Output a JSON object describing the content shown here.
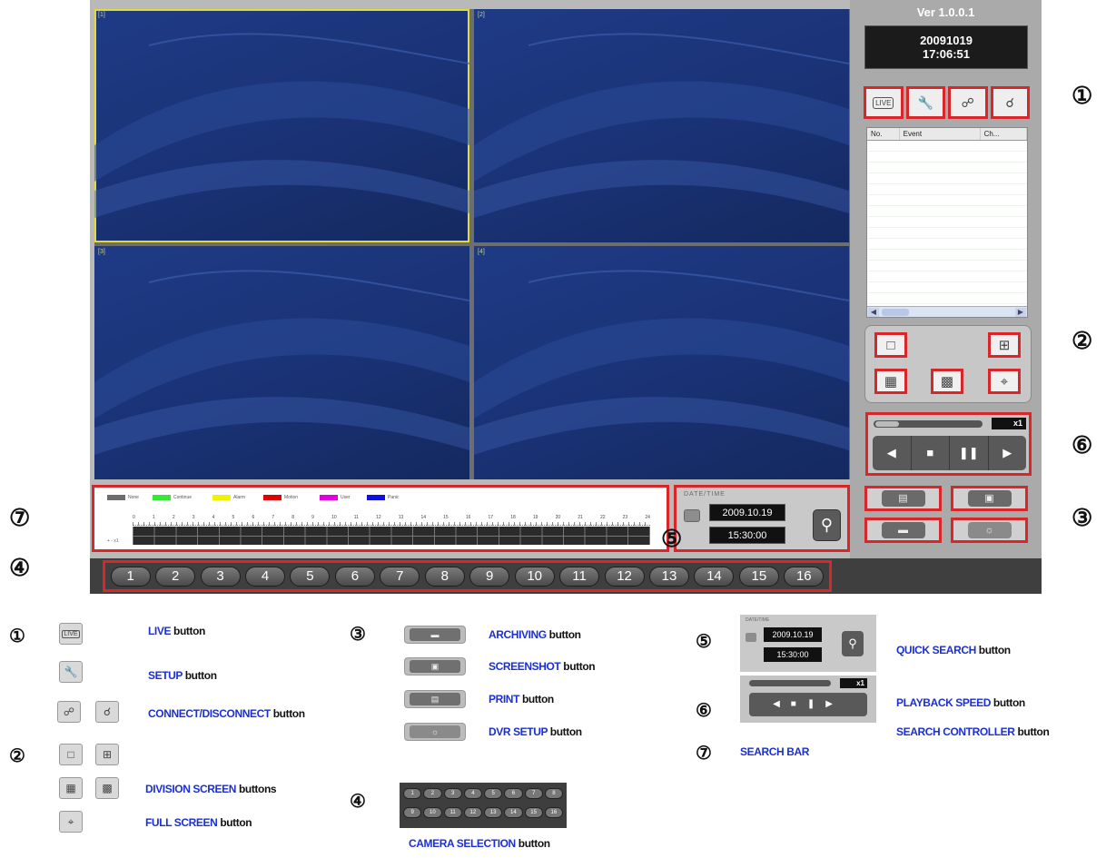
{
  "app": {
    "version": "Ver 1.0.0.1",
    "clock_date": "20091019",
    "clock_time": "17:06:51",
    "cameras": [
      {
        "label": "[1]",
        "selected": true
      },
      {
        "label": "[2]",
        "selected": false
      },
      {
        "label": "[3]",
        "selected": false
      },
      {
        "label": "[4]",
        "selected": false
      }
    ],
    "event_list": {
      "columns": [
        "No.",
        "Event",
        "Ch..."
      ]
    },
    "speed": "x1",
    "search_bar": {
      "legend": [
        "None",
        "Continue",
        "Alarm",
        "Motion",
        "User",
        "Panic"
      ],
      "legend_colors": [
        "#6d6d6d",
        "#35e835",
        "#f2f200",
        "#e00000",
        "#e000e0",
        "#1010e0"
      ],
      "hours": [
        "0",
        "1",
        "2",
        "3",
        "4",
        "5",
        "6",
        "7",
        "8",
        "9",
        "10",
        "11",
        "12",
        "13",
        "14",
        "15",
        "16",
        "17",
        "18",
        "19",
        "20",
        "21",
        "22",
        "23",
        "24"
      ],
      "zoom": "+ - x1"
    },
    "quick_search": {
      "title": "DATE/TIME",
      "date": "2009.10.19",
      "time": "15:30:00"
    },
    "camera_buttons": [
      "1",
      "2",
      "3",
      "4",
      "5",
      "6",
      "7",
      "8",
      "9",
      "10",
      "11",
      "12",
      "13",
      "14",
      "15",
      "16"
    ],
    "badges": {
      "b1": "①",
      "b2": "②",
      "b3": "③",
      "b4": "④",
      "b5": "⑤",
      "b6": "⑥",
      "b7": "⑦"
    },
    "accent_color": "#d9262a"
  },
  "legend": {
    "b1": "①",
    "b2": "②",
    "b3": "③",
    "b4": "④",
    "b5": "⑤",
    "b6": "⑥",
    "b7": "⑦",
    "live_kw": "LIVE",
    "live_rest": " button",
    "setup_kw": "SETUP",
    "setup_rest": " button",
    "connect_kw": "CONNECT/DISCONNECT",
    "connect_rest": " button",
    "division_kw": "DIVISION SCREEN",
    "division_rest": " buttons",
    "full_kw": "FULL SCREEN",
    "full_rest": " button",
    "archiving_kw": "ARCHIVING",
    "archiving_rest": " button",
    "screenshot_kw": "SCREENSHOT",
    "screenshot_rest": " button",
    "print_kw": "PRINT",
    "print_rest": " button",
    "dvrsetup_kw": "DVR SETUP",
    "dvrsetup_rest": " button",
    "camsel_kw": "CAMERA SELECTION",
    "camsel_rest": " button",
    "quick_kw": "QUICK SEARCH",
    "quick_rest": " button",
    "speed_kw": "PLAYBACK SPEED",
    "speed_rest": " button",
    "ctrl_kw": "SEARCH CONTROLLER",
    "ctrl_rest": " button",
    "searchbar_kw": "SEARCH BAR",
    "live_icon": "LIVE",
    "mini_date": "2009.10.19",
    "mini_time": "15:30:00",
    "mini_title": "DATE/TIME",
    "mini_speed": "x1",
    "mini_cams": [
      "1",
      "2",
      "3",
      "4",
      "5",
      "6",
      "7",
      "8",
      "9",
      "10",
      "11",
      "12",
      "13",
      "14",
      "15",
      "16"
    ]
  }
}
